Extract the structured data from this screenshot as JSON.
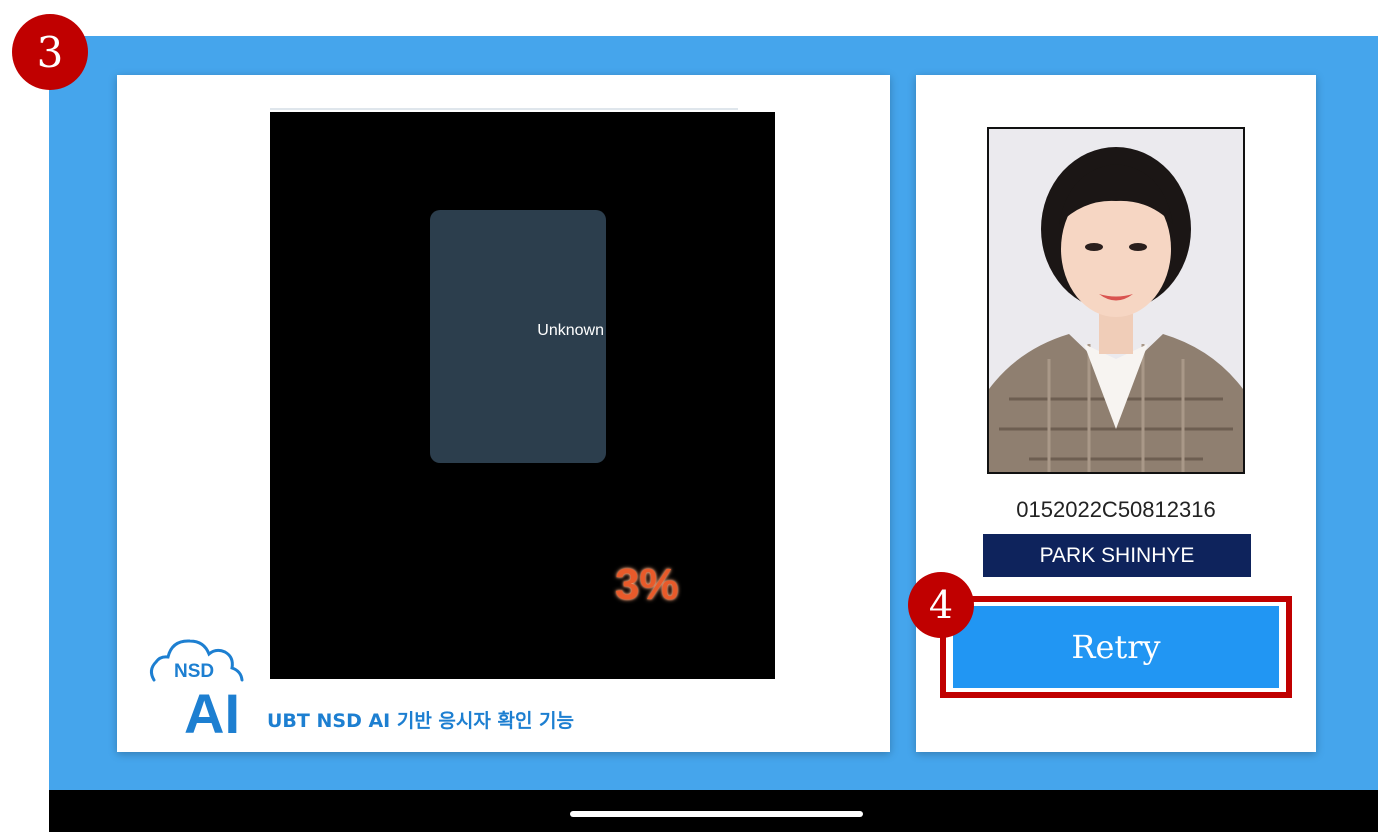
{
  "annotations": {
    "step_3": "3",
    "step_4": "4"
  },
  "scanner": {
    "face_label": "Unknown",
    "match_percent": "3%"
  },
  "branding": {
    "logo_top": "NSD",
    "logo_main": "AI",
    "caption": "UBT NSD AI 기반 응시자 확인 기능"
  },
  "candidate": {
    "id_number": "0152022C50812316",
    "name": "PARK SHINHYE"
  },
  "actions": {
    "retry_label": "Retry"
  },
  "colors": {
    "background_blue": "#45a5ec",
    "annotation_red": "#c00000",
    "retry_blue": "#2196f3",
    "name_plate_navy": "#0e235c",
    "percent_orange": "#e85a2a"
  }
}
